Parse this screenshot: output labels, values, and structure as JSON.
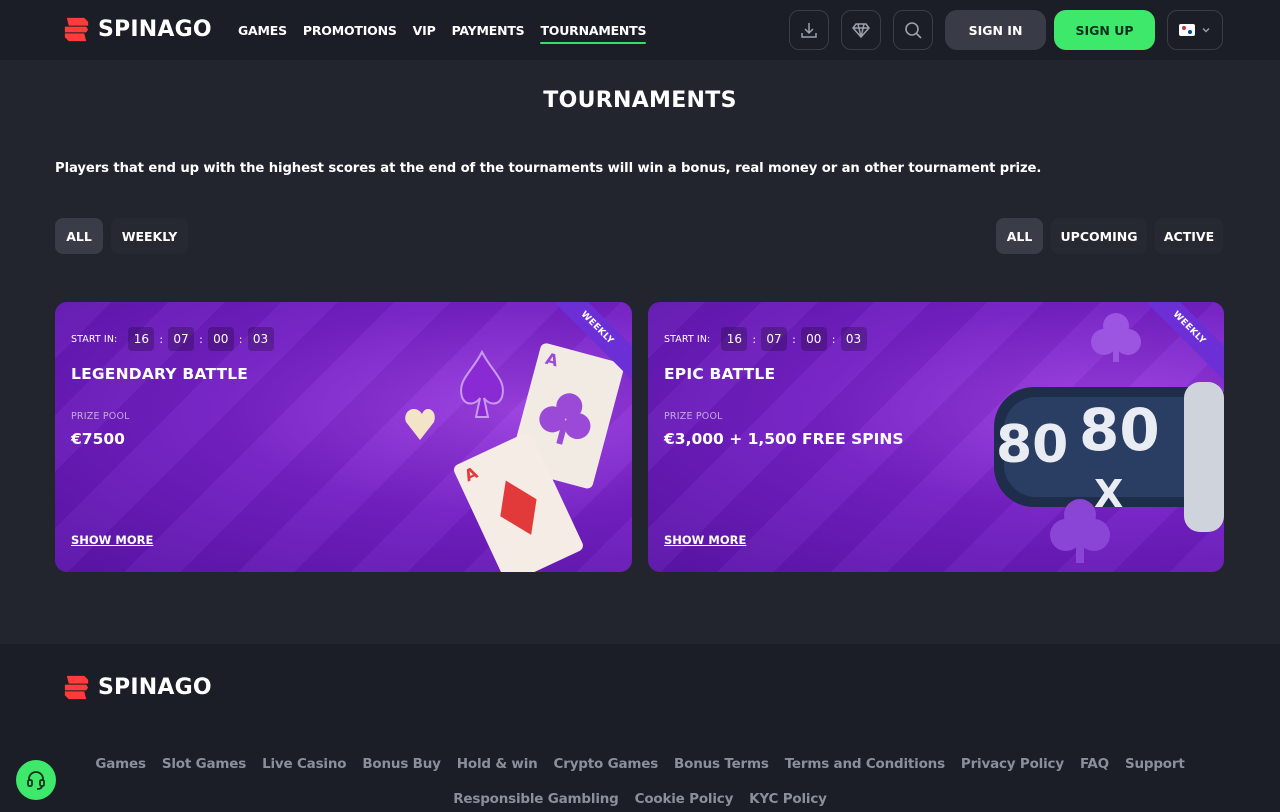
{
  "brand": {
    "name": "SPINAGO",
    "accent": "#3ee86a",
    "logo_red": "#ff3b3b"
  },
  "nav": {
    "items": [
      {
        "label": "GAMES",
        "active": false
      },
      {
        "label": "PROMOTIONS",
        "active": false
      },
      {
        "label": "VIP",
        "active": false
      },
      {
        "label": "PAYMENTS",
        "active": false
      },
      {
        "label": "TOURNAMENTS",
        "active": true
      }
    ]
  },
  "header_actions": {
    "icons": [
      "download-icon",
      "diamond-icon",
      "search-icon"
    ],
    "signin_label": "SIGN IN",
    "signup_label": "SIGN UP",
    "language_icon": "korean-flag-icon"
  },
  "page": {
    "title": "TOURNAMENTS",
    "description": "Players that end up with the highest scores at the end of the tournaments will win a bonus, real money or an other tournament prize."
  },
  "filters": {
    "type": [
      {
        "label": "ALL",
        "active": true
      },
      {
        "label": "WEEKLY",
        "active": false
      }
    ],
    "status": [
      {
        "label": "ALL",
        "active": true
      },
      {
        "label": "UPCOMING",
        "active": false
      },
      {
        "label": "ACTIVE",
        "active": false
      }
    ]
  },
  "tournaments": [
    {
      "ribbon": "WEEKLY",
      "start_label": "START IN:",
      "countdown": [
        "16",
        "07",
        "00",
        "03"
      ],
      "title": "LEGENDARY BATTLE",
      "prize_label": "PRIZE POOL",
      "prize_value": "€7500",
      "show_more": "SHOW MORE"
    },
    {
      "ribbon": "WEEKLY",
      "start_label": "START IN:",
      "countdown": [
        "16",
        "07",
        "00",
        "03"
      ],
      "title": "EPIC BATTLE",
      "prize_label": "PRIZE POOL",
      "prize_value": "€3,000 + 1,500 FREE SPINS",
      "show_more": "SHOW MORE",
      "art_text": "80 X"
    }
  ],
  "footer": {
    "brand": "SPINAGO",
    "links_row1": [
      "Games",
      "Slot Games",
      "Live Casino",
      "Bonus Buy",
      "Hold & win",
      "Crypto Games",
      "Bonus Terms",
      "Terms and Conditions",
      "Privacy Policy",
      "FAQ",
      "Support"
    ],
    "links_row2": [
      "Responsible Gambling",
      "Cookie Policy",
      "KYC Policy"
    ]
  },
  "support_fab": {
    "icon": "headset-icon"
  }
}
